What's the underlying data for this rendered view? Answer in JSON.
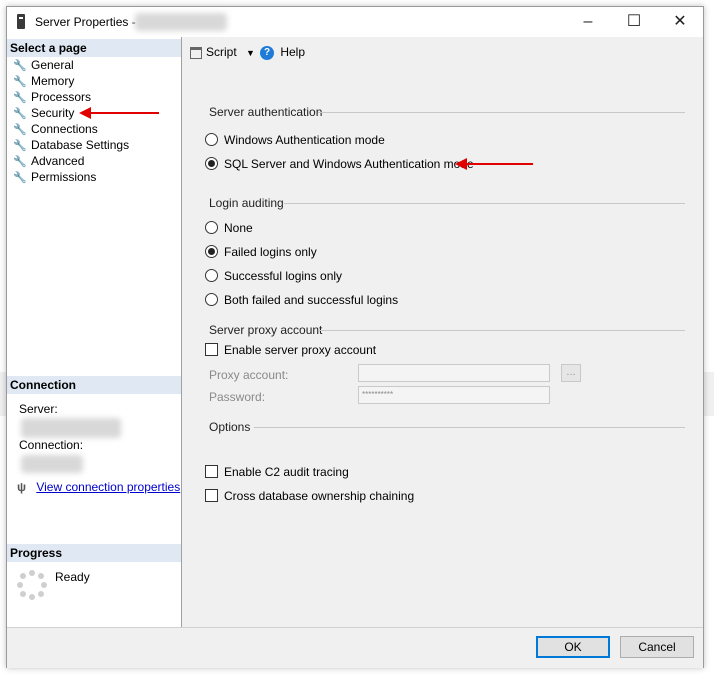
{
  "window": {
    "title": "Server Properties -",
    "minimize_icon": "minimize-icon",
    "maximize_icon": "maximize-icon",
    "close_icon": "close-icon"
  },
  "left_panel": {
    "select_page_header": "Select a page",
    "pages": [
      {
        "label": "General",
        "icon": "wrench-icon"
      },
      {
        "label": "Memory",
        "icon": "wrench-icon"
      },
      {
        "label": "Processors",
        "icon": "wrench-icon"
      },
      {
        "label": "Security",
        "icon": "wrench-icon"
      },
      {
        "label": "Connections",
        "icon": "wrench-icon"
      },
      {
        "label": "Database Settings",
        "icon": "wrench-icon"
      },
      {
        "label": "Advanced",
        "icon": "wrench-icon"
      },
      {
        "label": "Permissions",
        "icon": "wrench-icon"
      }
    ],
    "connection_header": "Connection",
    "server_label": "Server:",
    "connection_label": "Connection:",
    "view_connection_link": "View connection properties",
    "progress_header": "Progress",
    "progress_status": "Ready"
  },
  "toolbar": {
    "script_label": "Script",
    "help_label": "Help"
  },
  "server_authentication": {
    "title": "Server authentication",
    "options": [
      {
        "label": "Windows Authentication mode",
        "selected": false
      },
      {
        "label": "SQL Server and Windows Authentication mode",
        "selected": true
      }
    ]
  },
  "login_auditing": {
    "title": "Login auditing",
    "options": [
      {
        "label": "None",
        "selected": false
      },
      {
        "label": "Failed logins only",
        "selected": true
      },
      {
        "label": "Successful logins only",
        "selected": false
      },
      {
        "label": "Both failed and successful logins",
        "selected": false
      }
    ]
  },
  "server_proxy": {
    "title": "Server proxy account",
    "enable_label": "Enable server proxy account",
    "enabled": false,
    "proxy_account_label": "Proxy account:",
    "proxy_account_value": "",
    "browse_label": "...",
    "password_label": "Password:",
    "password_value": "**********"
  },
  "options": {
    "title": "Options",
    "c2_audit_label": "Enable C2 audit tracing",
    "c2_audit_checked": false,
    "cross_db_label": "Cross database ownership chaining",
    "cross_db_checked": false
  },
  "footer": {
    "ok_label": "OK",
    "cancel_label": "Cancel"
  }
}
